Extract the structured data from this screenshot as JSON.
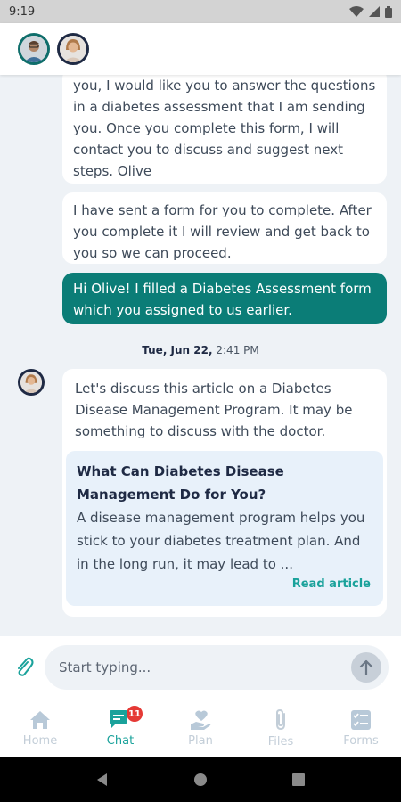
{
  "status": {
    "time": "9:19"
  },
  "messages": [
    {
      "text": "you, I would like you to answer the questions in a diabetes assessment that I am sending you. Once you complete this form, I will contact you to discuss and suggest next steps. Olive"
    },
    {
      "text": "I have sent a form for you to complete. After you complete it I will review and get back to you so we can proceed."
    },
    {
      "text": "Hi Olive! I filled a Diabetes Assessment form which you assigned to us earlier."
    }
  ],
  "date_separator": {
    "date": "Tue, Jun 22,",
    "time": "2:41 PM"
  },
  "article_message": {
    "text": "Let's discuss this article on a Diabetes Disease Management Program. It may be something to discuss with the doctor.",
    "title": "What Can Diabetes Disease Management Do for You?",
    "body": "A disease management program helps you stick to your diabetes treatment plan. And in the long run, it may lead to ...",
    "link": "Read article"
  },
  "composer": {
    "placeholder": "Start typing..."
  },
  "nav": {
    "home": "Home",
    "chat": "Chat",
    "chat_badge": "11",
    "plan": "Plan",
    "files": "Files",
    "forms": "Forms"
  },
  "colors": {
    "accent": "#1aa29b",
    "outgoing": "#0b7d77",
    "navy": "#1f2a44"
  }
}
